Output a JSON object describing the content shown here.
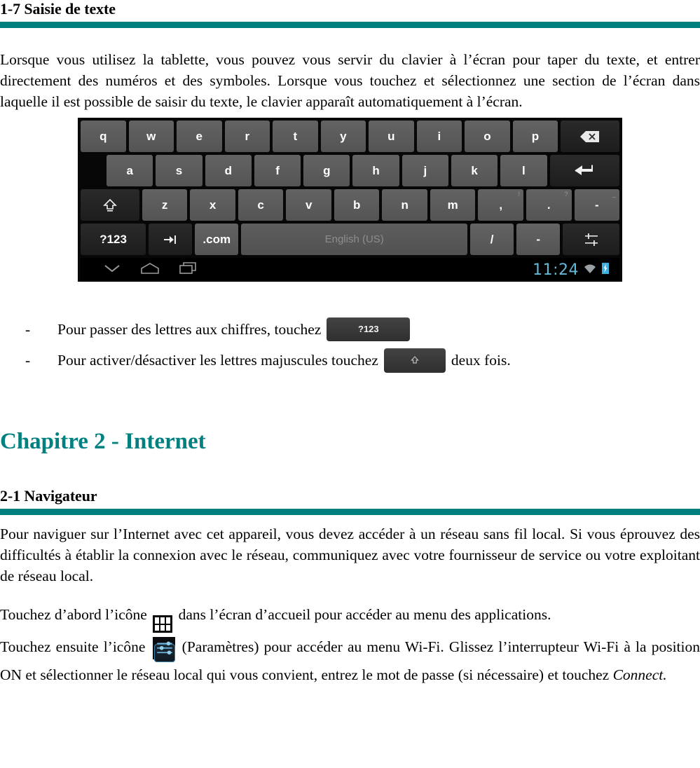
{
  "document": {
    "section_1": {
      "heading": "1-7 Saisie de texte",
      "paragraph": "Lorsque vous utilisez la tablette, vous pouvez vous servir du clavier à l’écran pour taper du texte, et entrer directement des numéros et des symboles. Lorsque vous touchez et sélectionnez une section de l’écran dans laquelle il est possible de saisir du texte, le clavier apparaît automatiquement à l’écran."
    },
    "keyboard": {
      "row1": [
        "q",
        "w",
        "e",
        "r",
        "t",
        "y",
        "u",
        "i",
        "o",
        "p"
      ],
      "row1_action": "backspace-key",
      "row2": [
        "a",
        "s",
        "d",
        "f",
        "g",
        "h",
        "j",
        "k",
        "l"
      ],
      "row2_action": "enter-key",
      "row3_shift": "shift-key",
      "row3": [
        "z",
        "x",
        "c",
        "v",
        "b",
        "n",
        "m"
      ],
      "row3_punct": [
        {
          "label": ",",
          "alt": "!"
        },
        {
          "label": ".",
          "alt": "?"
        },
        {
          "label": "-",
          "alt": "_"
        }
      ],
      "row4": {
        "symbols_key": "?123",
        "tab_key": "tab-key",
        "dotcom_key": ".com",
        "space_label": "English (US)",
        "slash_key": "/",
        "dash_key": "-",
        "settings_key": "keyboard-settings-key"
      },
      "navbar": {
        "hide_keyboard": "chevron-down-icon",
        "home": "home-icon",
        "recents": "recents-icon",
        "clock": "11:24",
        "wifi": "wifi-icon",
        "battery": "battery-charging-icon"
      }
    },
    "bullets": [
      {
        "dash": "-",
        "text_before": "Pour passer des lettres aux chiffres, touchez",
        "chip": "?123",
        "text_after": ""
      },
      {
        "dash": "-",
        "text_before": "Pour activer/désactiver les lettres majuscules touchez",
        "chip": "shift-arrow",
        "text_after": "deux fois."
      }
    ],
    "section_2": {
      "chapter_heading": "Chapitre 2 - Internet",
      "heading": "2-1 Navigateur",
      "paragraph_1": "Pour naviguer sur l’Internet avec cet appareil, vous devez accéder à un réseau sans fil local. Si vous éprouvez des difficultés à établir la connexion avec le réseau, communiquez avec votre fournisseur de service ou votre exploitant de réseau local.",
      "paragraph_2_part1": "Touchez d’abord l’icône",
      "paragraph_2_icon": "apps-grid-icon",
      "paragraph_2_part2": "dans l’écran d’accueil pour accéder au menu des applications.",
      "paragraph_3_part1": "Touchez ensuite l’icône",
      "paragraph_3_icon": "settings-icon",
      "paragraph_3_part2": "(Paramètres) pour accéder au menu Wi-Fi. Glissez l’interrupteur Wi-Fi à la position ON et sélectionner le réseau local qui vous convient, entrez le mot de passe (si nécessaire) et touchez",
      "paragraph_3_italic": "Connect."
    }
  },
  "colors": {
    "teal_rule": "#007F7F",
    "chapter_heading": "#00807E",
    "clock_blue": "#63B8D8",
    "key_gray": "#5C5C5C",
    "key_dark": "#232323",
    "keyboard_bg": "#070707"
  }
}
